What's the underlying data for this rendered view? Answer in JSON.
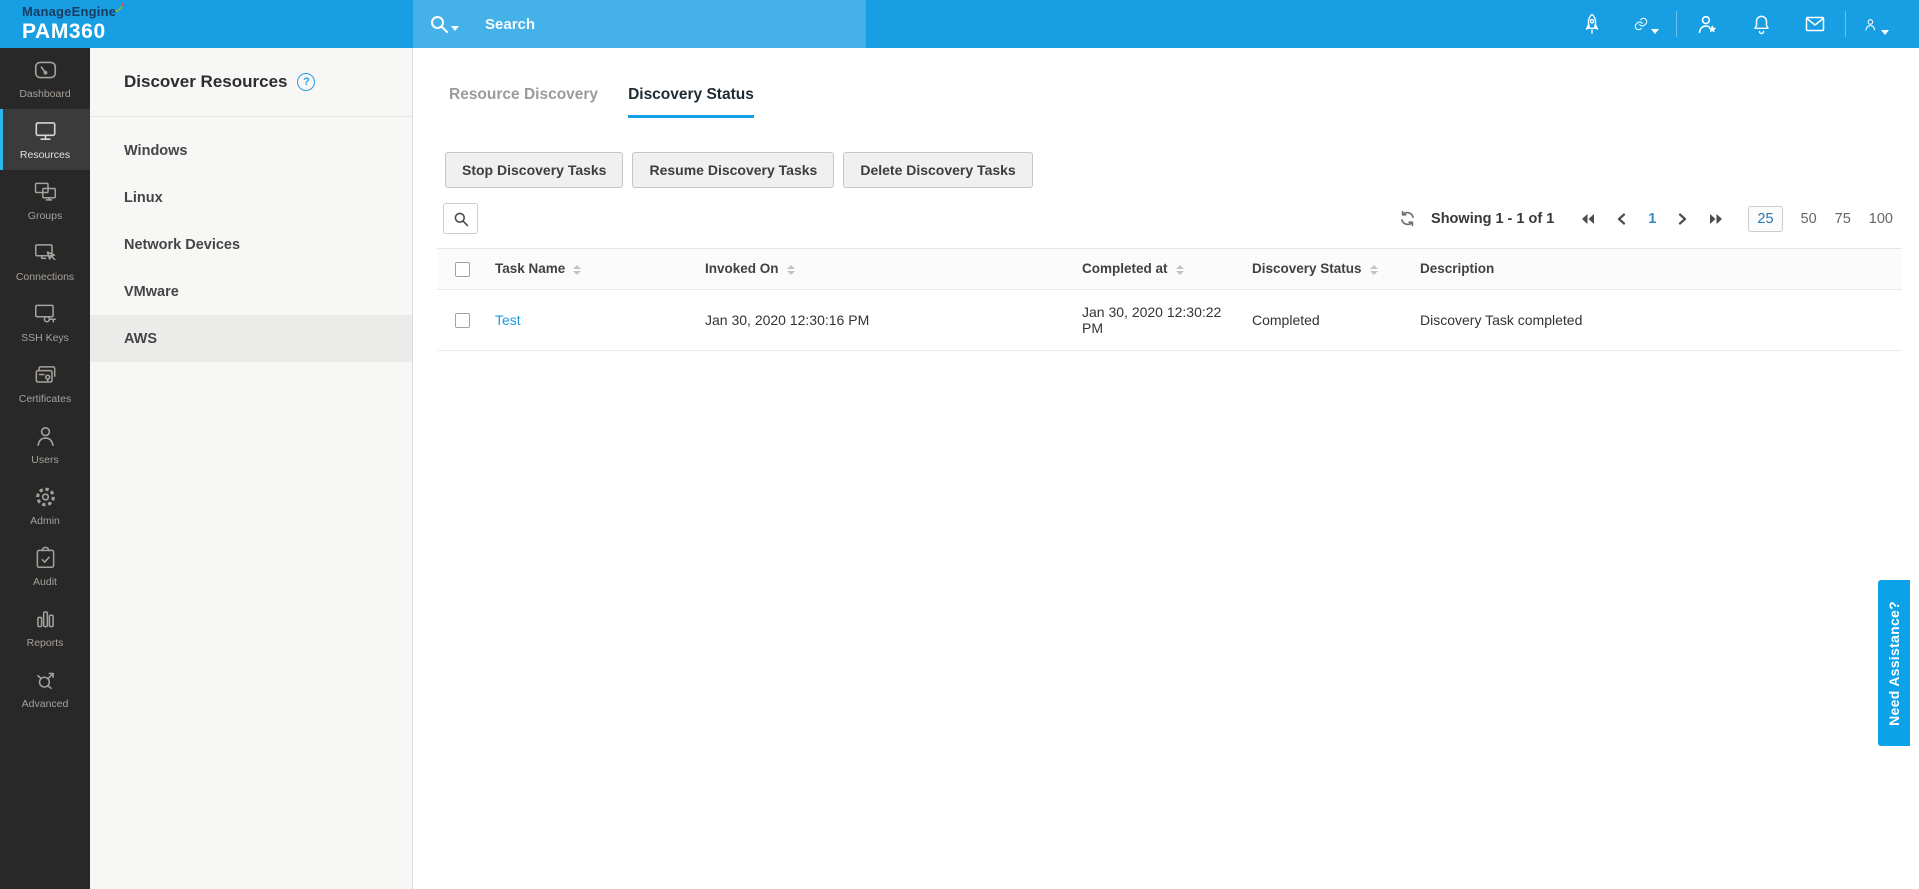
{
  "brand": {
    "company": "ManageEngine",
    "product": "PAM360"
  },
  "header": {
    "search_placeholder": "Search"
  },
  "top_icons": [
    "rocket-icon",
    "link-icon",
    "user-star-icon",
    "bell-icon",
    "mail-icon",
    "user-icon"
  ],
  "sidebar": {
    "items": [
      {
        "label": "Dashboard",
        "icon": "gauge-icon",
        "active": false
      },
      {
        "label": "Resources",
        "icon": "monitor-icon",
        "active": true
      },
      {
        "label": "Groups",
        "icon": "monitors-group-icon",
        "active": false
      },
      {
        "label": "Connections",
        "icon": "monitor-cursor-icon",
        "active": false
      },
      {
        "label": "SSH Keys",
        "icon": "monitor-key-icon",
        "active": false
      },
      {
        "label": "Certificates",
        "icon": "certificate-cards-icon",
        "active": false
      },
      {
        "label": "Users",
        "icon": "person-icon",
        "active": false
      },
      {
        "label": "Admin",
        "icon": "gear-icon",
        "active": false
      },
      {
        "label": "Audit",
        "icon": "clipboard-check-icon",
        "active": false
      },
      {
        "label": "Reports",
        "icon": "bar-chart-icon",
        "active": false
      },
      {
        "label": "Advanced",
        "icon": "share-arrows-icon",
        "active": false
      }
    ]
  },
  "panel": {
    "title": "Discover Resources",
    "help_glyph": "?",
    "items": [
      {
        "label": "Windows",
        "active": false
      },
      {
        "label": "Linux",
        "active": false
      },
      {
        "label": "Network Devices",
        "active": false
      },
      {
        "label": "VMware",
        "active": false
      },
      {
        "label": "AWS",
        "active": true
      }
    ]
  },
  "tabs": [
    {
      "label": "Resource Discovery",
      "active": false
    },
    {
      "label": "Discovery Status",
      "active": true
    }
  ],
  "toolbar": {
    "stop_label": "Stop Discovery Tasks",
    "resume_label": "Resume Discovery Tasks",
    "delete_label": "Delete Discovery Tasks"
  },
  "pagination": {
    "showing_text": "Showing 1 - 1 of 1",
    "current_page": "1",
    "page_sizes": [
      "25",
      "50",
      "75",
      "100"
    ],
    "selected_page_size": "25"
  },
  "table": {
    "columns": [
      {
        "label": "Task Name",
        "sortable": true
      },
      {
        "label": "Invoked On",
        "sortable": true
      },
      {
        "label": "Completed at",
        "sortable": true
      },
      {
        "label": "Discovery Status",
        "sortable": true
      },
      {
        "label": "Description",
        "sortable": false
      }
    ],
    "rows": [
      {
        "task_name": "Test",
        "invoked_on": "Jan 30, 2020 12:30:16 PM",
        "completed_at": "Jan 30, 2020 12:30:22 PM",
        "discovery_status": "Completed",
        "description": "Discovery Task completed"
      }
    ]
  },
  "assistance": {
    "label": "Need Assistance?"
  },
  "colors": {
    "header_blue": "#189fe3",
    "search_blue": "#44b1e8",
    "accent_blue": "#14a0e6",
    "link_blue": "#1e9ce0",
    "ribbon_blue": "#0ba2e8",
    "sidebar_bg": "#282828",
    "sidebar_active_accent": "#2db5ef",
    "panel_bg": "#f7f7f5"
  }
}
